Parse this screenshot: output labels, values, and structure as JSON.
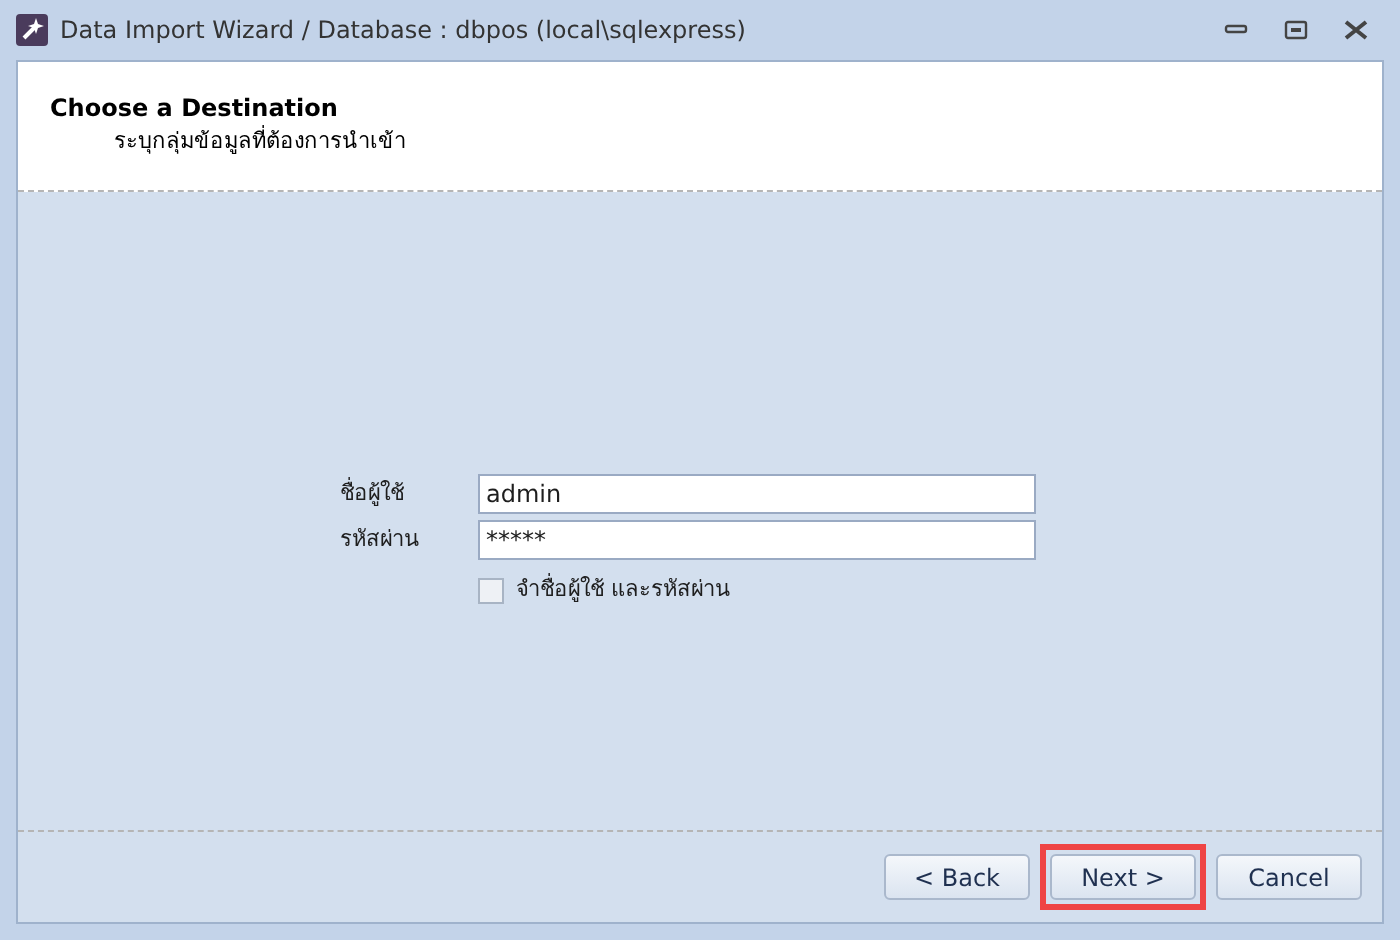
{
  "window": {
    "title": "Data Import Wizard / Database : dbpos (local\\sqlexpress)"
  },
  "header": {
    "title": "Choose a Destination",
    "subtitle": "ระบุกลุ่มข้อมูลที่ต้องการนำเข้า"
  },
  "fields": [
    {
      "label": "ชื่อผู้ใช้",
      "value": "admin"
    },
    {
      "label": "รหัสผ่าน",
      "value": "*****"
    }
  ],
  "remember": {
    "label": "จำชื่อผู้ใช้ และรหัสผ่าน",
    "checked": false
  },
  "buttons": [
    {
      "label": "< Back",
      "highlighted": false
    },
    {
      "label": "Next >",
      "highlighted": true
    },
    {
      "label": "Cancel",
      "highlighted": false
    }
  ]
}
